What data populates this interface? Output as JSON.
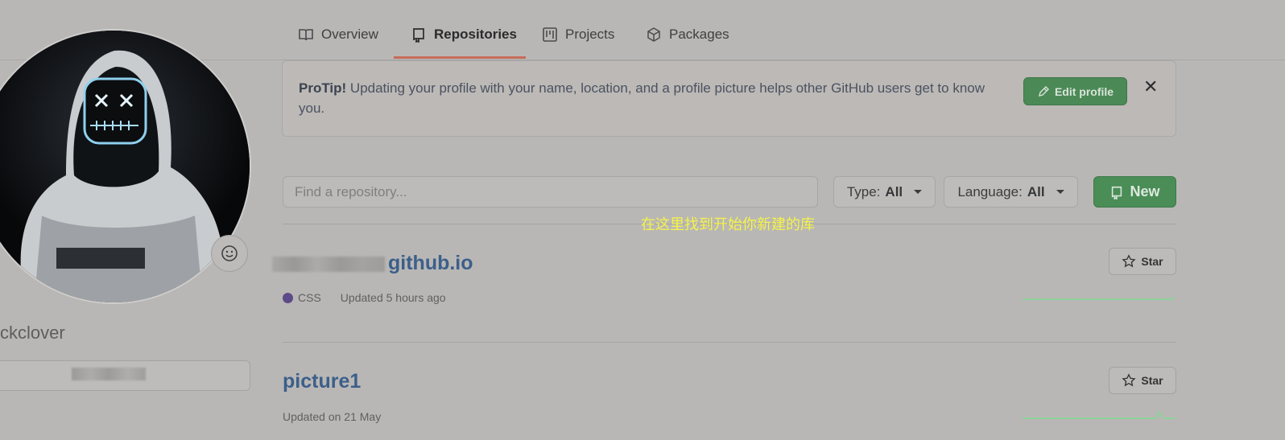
{
  "nav": {
    "tabs": [
      {
        "label": "Overview",
        "icon": "book-icon"
      },
      {
        "label": "Repositories",
        "icon": "repo-icon",
        "active": true
      },
      {
        "label": "Projects",
        "icon": "project-icon"
      },
      {
        "label": "Packages",
        "icon": "package-icon"
      }
    ]
  },
  "profile": {
    "username": "ckclover",
    "status_icon": "smiley-icon"
  },
  "protip": {
    "prefix": "ProTip!",
    "text": " Updating your profile with your name, location, and a profile picture helps other GitHub users get to know you.",
    "edit_label": "Edit profile",
    "close_label": "✕"
  },
  "filters": {
    "search_placeholder": "Find a repository...",
    "type_label": "Type:",
    "type_value": "All",
    "language_label": "Language:",
    "language_value": "All",
    "new_label": "New"
  },
  "annotation": "在这里找到开始你新建的库",
  "repos": [
    {
      "name": "github.io",
      "language": "CSS",
      "language_color": "#563d7c",
      "updated": "Updated 5 hours ago",
      "star_label": "Star"
    },
    {
      "name": "picture1",
      "language": "",
      "updated": "Updated on 21 May",
      "star_label": "Star"
    }
  ],
  "colors": {
    "accent_green": "#4b8a56",
    "link_blue": "#3c5f8a",
    "tab_underline": "#c56c5a",
    "annotation_yellow": "#f4f34a"
  }
}
